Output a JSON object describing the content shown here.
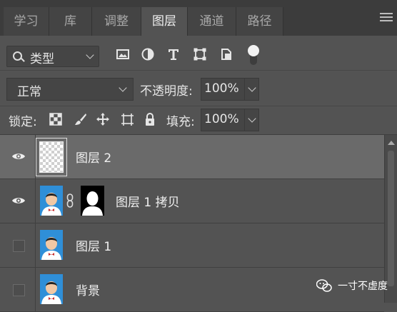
{
  "tabs": [
    {
      "label": "学习",
      "active": false
    },
    {
      "label": "库",
      "active": false
    },
    {
      "label": "调整",
      "active": false
    },
    {
      "label": "图层",
      "active": true
    },
    {
      "label": "通道",
      "active": false
    },
    {
      "label": "路径",
      "active": false
    }
  ],
  "filter": {
    "kind_label": "类型",
    "icons": [
      "image-filter-icon",
      "adjustment-filter-icon",
      "type-filter-icon",
      "shape-filter-icon",
      "smart-object-filter-icon"
    ]
  },
  "blend": {
    "mode": "正常",
    "opacity_label": "不透明度:",
    "opacity_value": "100%"
  },
  "lock": {
    "label": "锁定:",
    "fill_label": "填充:",
    "fill_value": "100%",
    "icons": [
      "lock-transparent-pixels-icon",
      "lock-image-pixels-icon",
      "lock-position-icon",
      "artboard-autonest-icon",
      "lock-all-icon"
    ]
  },
  "layers": [
    {
      "name": "图层 2",
      "visible": true,
      "selected": true,
      "thumb": "transparent",
      "mask": false
    },
    {
      "name": "图层 1 拷贝",
      "visible": true,
      "selected": false,
      "thumb": "photo",
      "mask": true
    },
    {
      "name": "图层 1",
      "visible": false,
      "selected": false,
      "thumb": "photo",
      "mask": false
    },
    {
      "name": "背景",
      "visible": false,
      "selected": false,
      "thumb": "photo",
      "mask": false
    }
  ],
  "watermark": {
    "text": "一寸不虚度"
  },
  "colors": {
    "panel": "#535353",
    "tabbar": "#3c3c3c",
    "selected_row": "#6a6a6a",
    "photo_bg": "#2f8fd8"
  }
}
